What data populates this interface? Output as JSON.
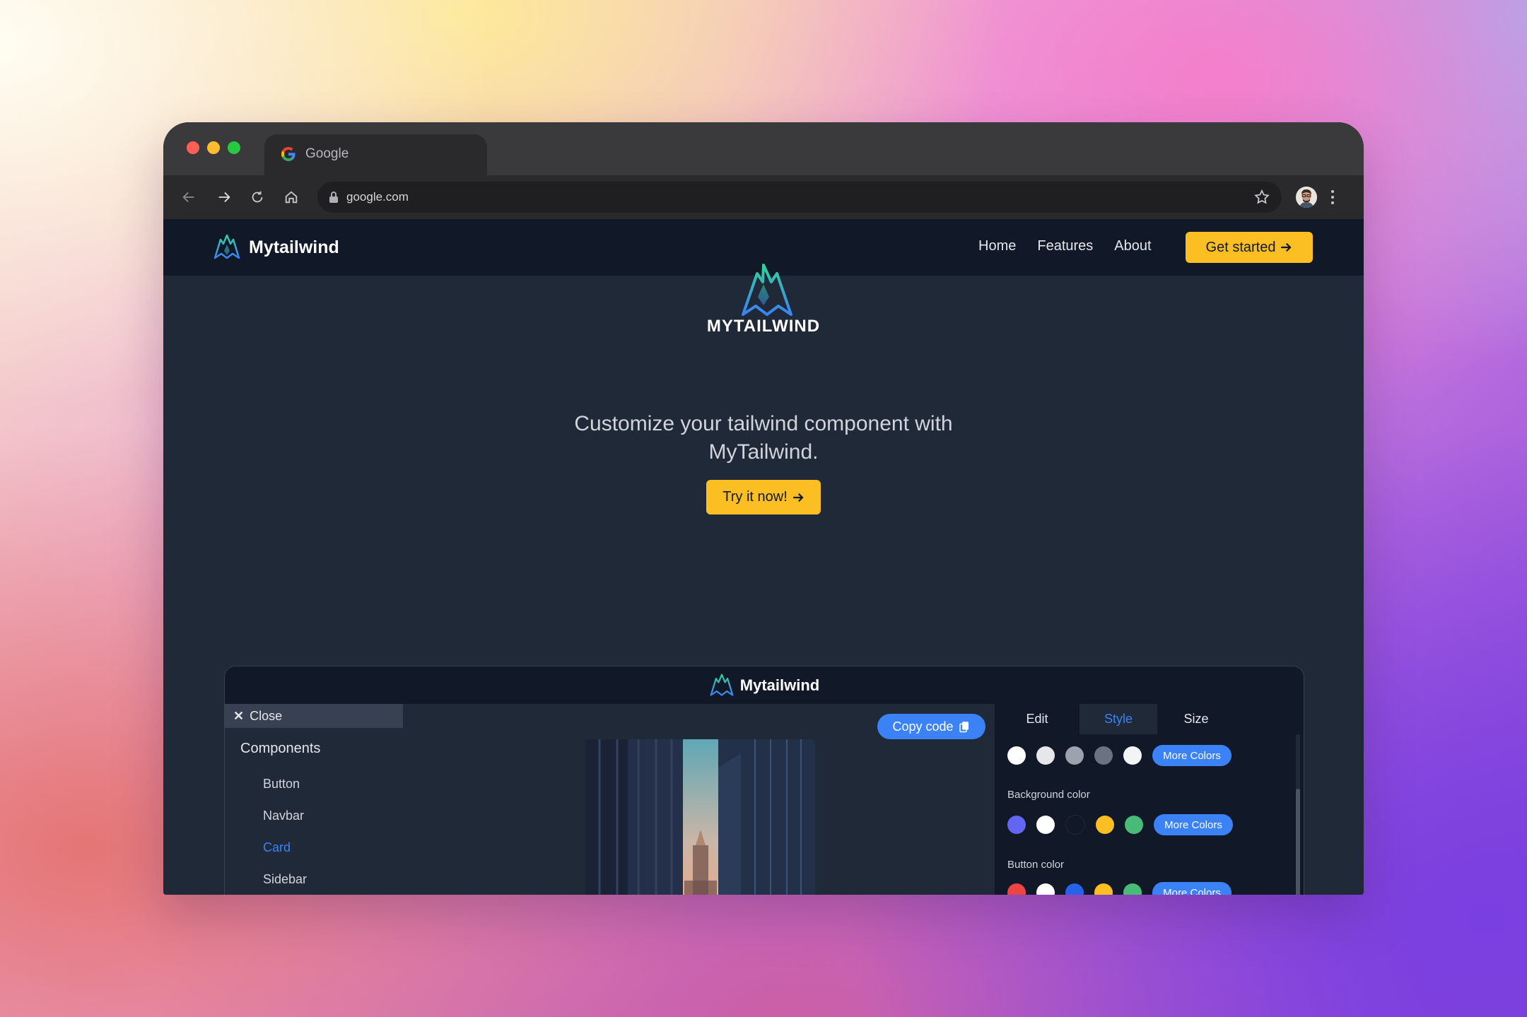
{
  "browser": {
    "tab_title": "Google",
    "url": "google.com"
  },
  "site": {
    "brand_name": "Mytailwind",
    "nav": {
      "home": "Home",
      "features": "Features",
      "about": "About",
      "cta_label": "Get started",
      "cta_icon": "arrow-right-icon"
    },
    "hero": {
      "wordmark": "MYTAILWIND",
      "headline": "Customize your tailwind component with MyTailwind.",
      "cta_label": "Try it now!",
      "cta_icon": "arrow-right-icon"
    }
  },
  "demo": {
    "brand_name": "Mytailwind",
    "sidebar": {
      "close_label": "Close",
      "section_title": "Components",
      "items": [
        "Button",
        "Navbar",
        "Card",
        "Sidebar"
      ],
      "active_item": "Card"
    },
    "copy_label": "Copy code",
    "panel": {
      "tabs": [
        "Edit",
        "Style",
        "Size"
      ],
      "active_tab": "Style",
      "text_colors": [
        "#ffffff",
        "#e5e7eb",
        "#9ca3af",
        "#6b7280",
        "#f3f4f6"
      ],
      "background_label": "Background color",
      "background_colors": [
        "#6366f1",
        "#ffffff",
        "#111827",
        "#fbbf24",
        "#48bb78"
      ],
      "button_label": "Button color",
      "button_colors": [
        "#ef4444",
        "#ffffff",
        "#2563eb",
        "#fbbf24",
        "#48bb78"
      ],
      "more_colors_label": "More Colors"
    }
  },
  "colors": {
    "accent_yellow": "#fbbf24",
    "accent_blue": "#3b82f6",
    "nav_bg": "#111827",
    "page_bg": "#1f2937"
  }
}
